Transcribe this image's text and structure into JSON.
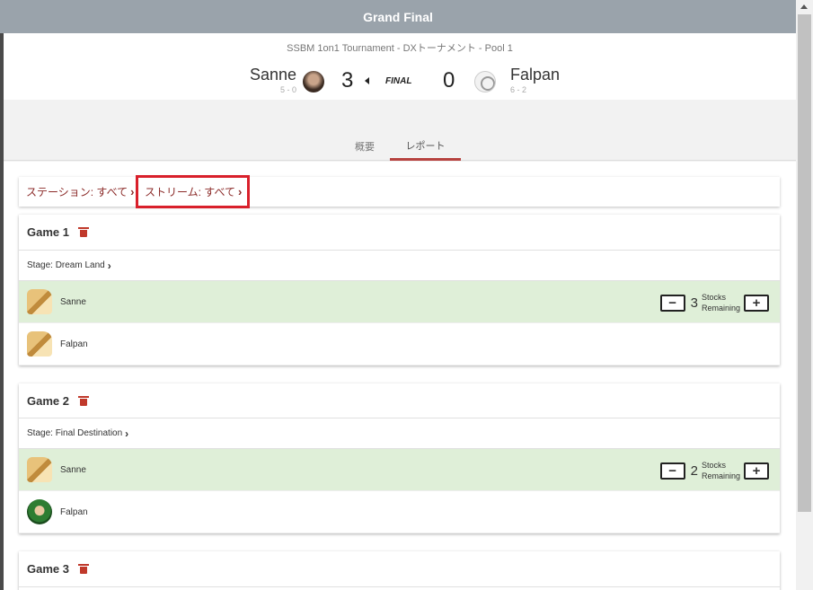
{
  "header": {
    "title": "Grand Final"
  },
  "match": {
    "tournament": "SSBM 1on1 Tournament - DXトーナメント - Pool 1",
    "left": {
      "name": "Sanne",
      "record": "5 - 0",
      "score": "3"
    },
    "right": {
      "name": "Falpan",
      "record": "6 - 2",
      "score": "0"
    },
    "status": "FINAL"
  },
  "tabs": [
    {
      "label": "概要"
    },
    {
      "label": "レポート"
    }
  ],
  "filters": {
    "station": "ステーション: すべて",
    "stream": "ストリーム: すべて"
  },
  "games": [
    {
      "title": "Game 1",
      "stage": "Stage: Dream Land",
      "players": [
        {
          "name": "Sanne",
          "character": "fox-icon",
          "winner": true,
          "stocks": "3"
        },
        {
          "name": "Falpan",
          "character": "fox-icon",
          "winner": false
        }
      ]
    },
    {
      "title": "Game 2",
      "stage": "Stage: Final Destination",
      "players": [
        {
          "name": "Sanne",
          "character": "fox-icon",
          "winner": true,
          "stocks": "2"
        },
        {
          "name": "Falpan",
          "character": "link-icon",
          "winner": false
        }
      ]
    },
    {
      "title": "Game 3"
    }
  ],
  "stocks_label_line1": "Stocks",
  "stocks_label_line2": "Remaining",
  "icons": {
    "minus": "−",
    "plus": "+",
    "chevron": "›"
  },
  "colors": {
    "accent": "#b6423f",
    "winner_row": "#dfefd8",
    "header": "#9aa3ab",
    "highlight": "#d9202b"
  }
}
